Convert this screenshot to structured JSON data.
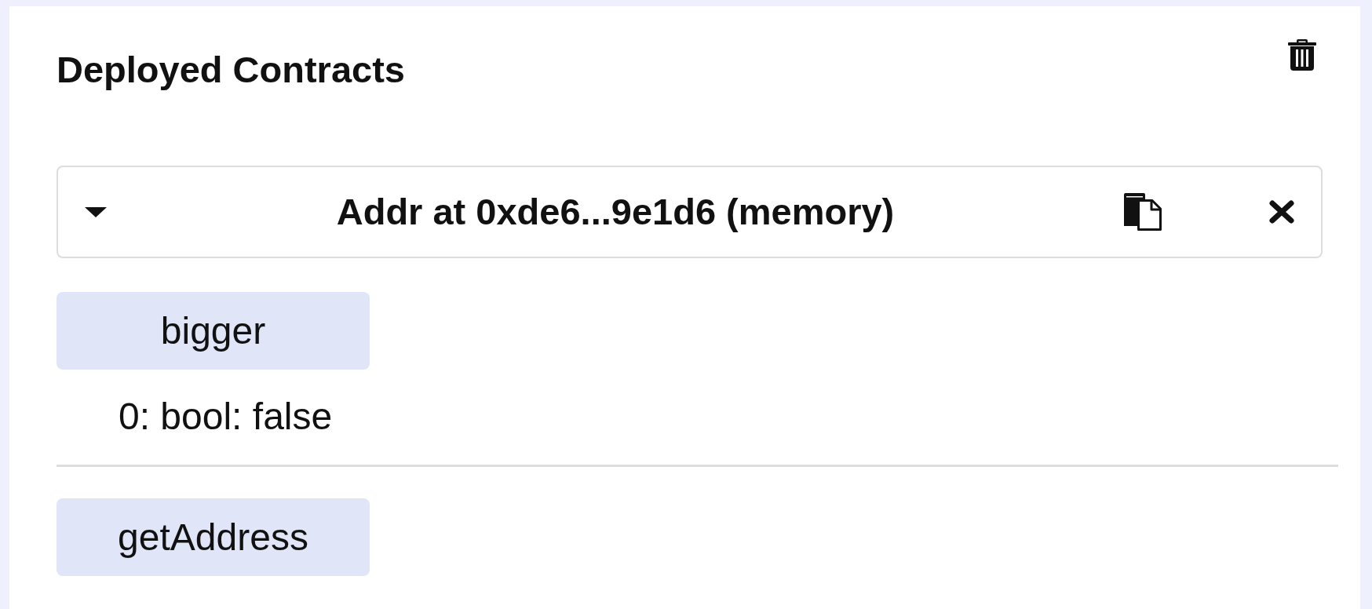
{
  "panel": {
    "title": "Deployed Contracts"
  },
  "instances": [
    {
      "title": "Addr at 0xde6...9e1d6 (memory)",
      "expanded": true,
      "functions": [
        {
          "label": "bigger",
          "outputs": [
            "0: bool: false"
          ]
        },
        {
          "label": "getAddress"
        }
      ]
    }
  ]
}
